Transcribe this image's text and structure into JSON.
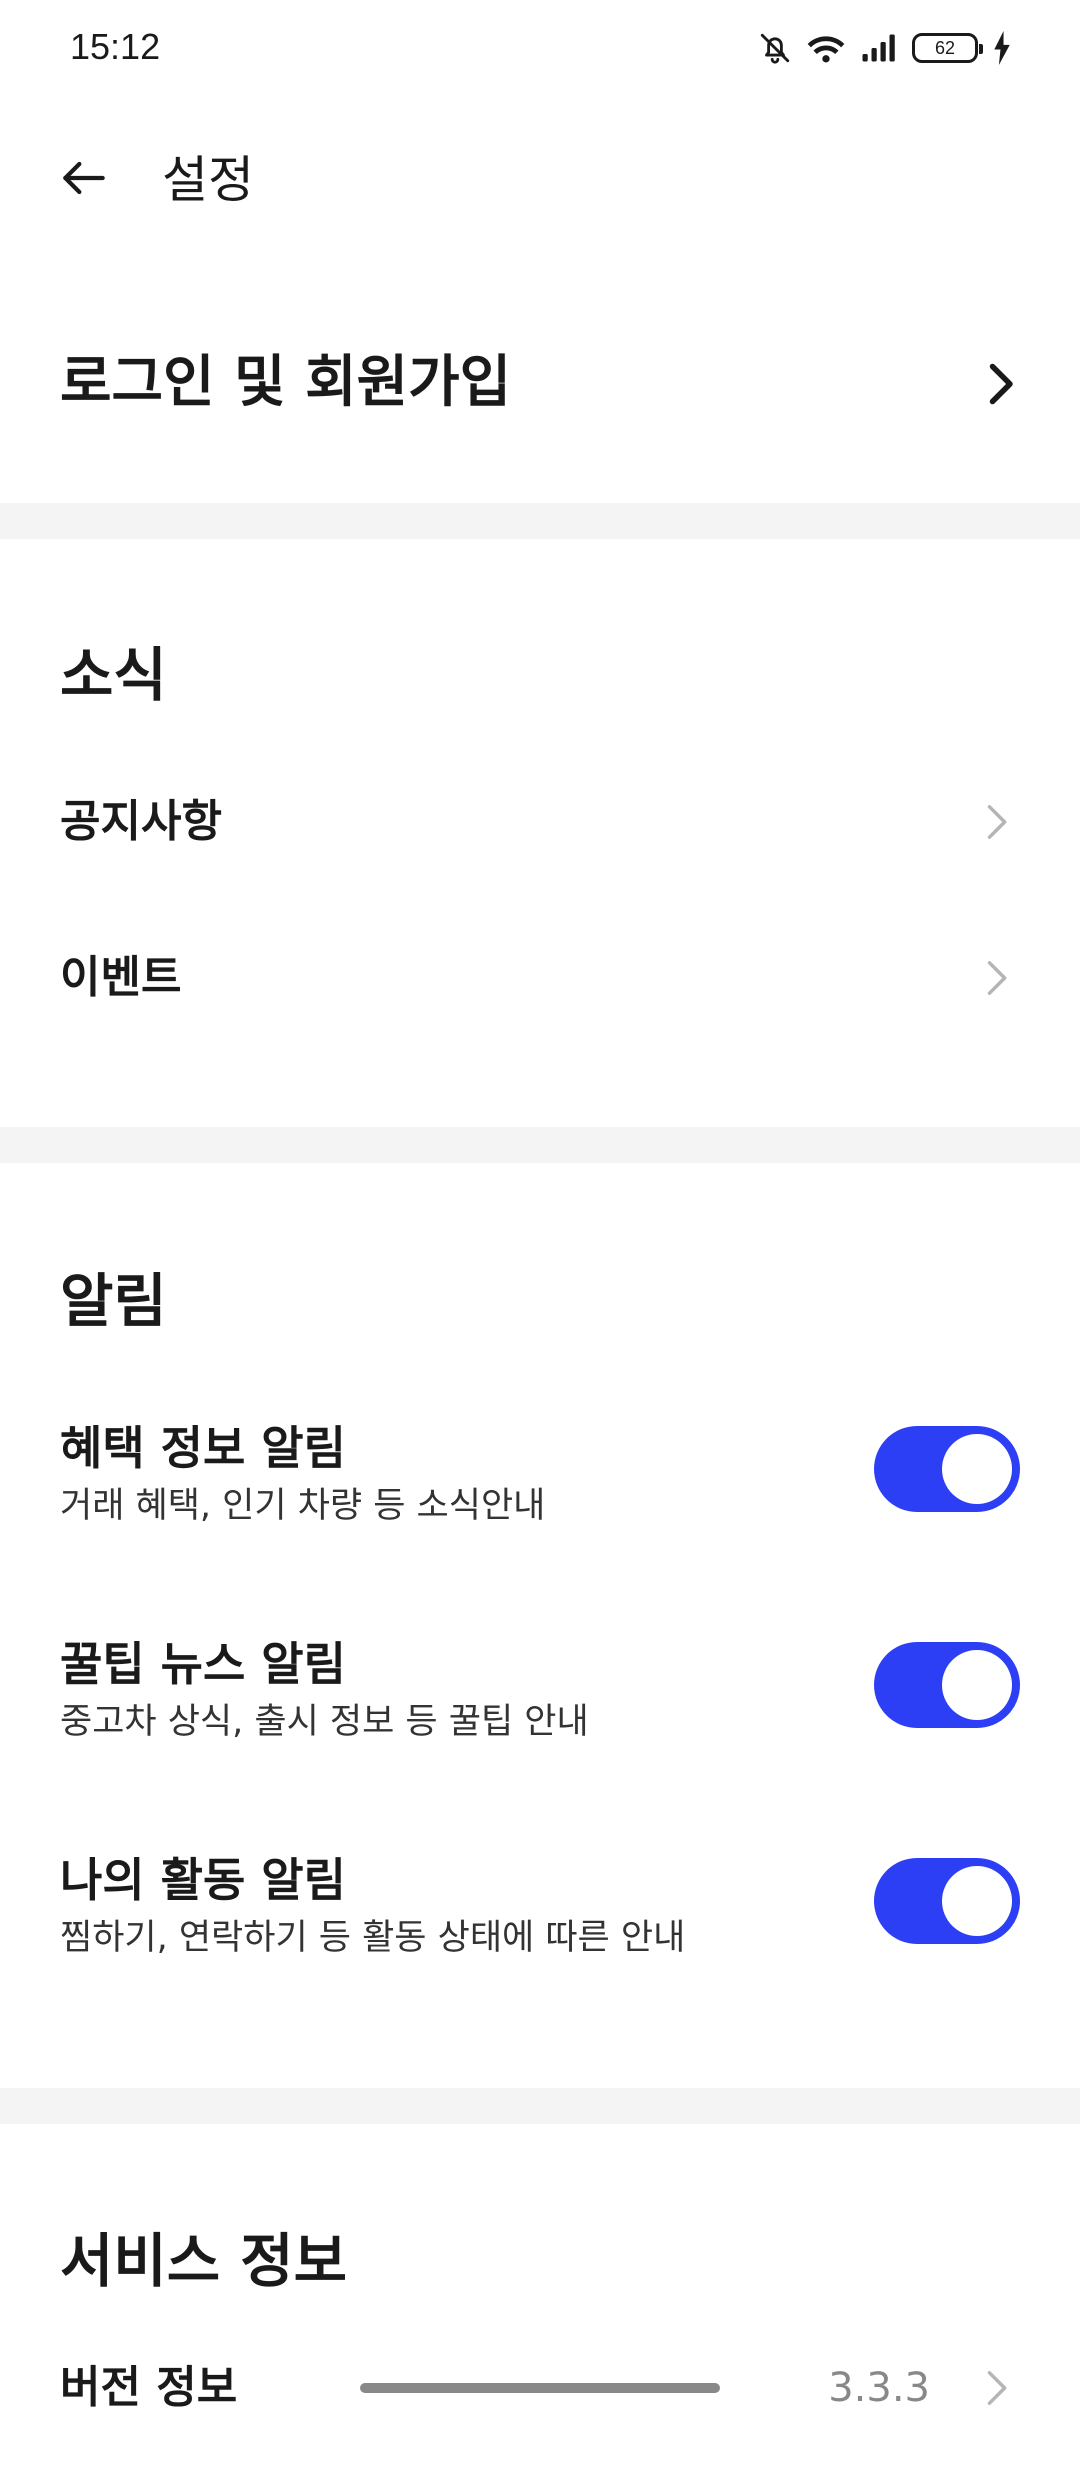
{
  "status_bar": {
    "time": "15:12",
    "battery_level": "62",
    "icons": [
      "bell-off-icon",
      "wifi-icon",
      "signal-icon",
      "battery-icon",
      "charging-icon"
    ]
  },
  "header": {
    "title": "설정",
    "back_icon": "arrow-left-icon"
  },
  "login": {
    "label": "로그인 및 회원가입"
  },
  "sections": {
    "news": {
      "title": "소식",
      "items": [
        {
          "label": "공지사항"
        },
        {
          "label": "이벤트"
        }
      ]
    },
    "notifications": {
      "title": "알림",
      "items": [
        {
          "title": "혜택 정보 알림",
          "description": "거래 혜택, 인기 차량 등 소식안내",
          "enabled": true
        },
        {
          "title": "꿀팁 뉴스 알림",
          "description": "중고차 상식, 출시 정보 등 꿀팁 안내",
          "enabled": true
        },
        {
          "title": "나의 활동 알림",
          "description": "찜하기, 연락하기 등 활동 상태에 따른 안내",
          "enabled": true
        }
      ]
    },
    "service_info": {
      "title": "서비스 정보",
      "version_label": "버전 정보",
      "version_value": "3.3.3"
    }
  },
  "colors": {
    "accent": "#2d3ff5",
    "divider": "#f4f4f4",
    "text": "#1a1a1a",
    "chevron_muted": "#b5b5b5"
  }
}
